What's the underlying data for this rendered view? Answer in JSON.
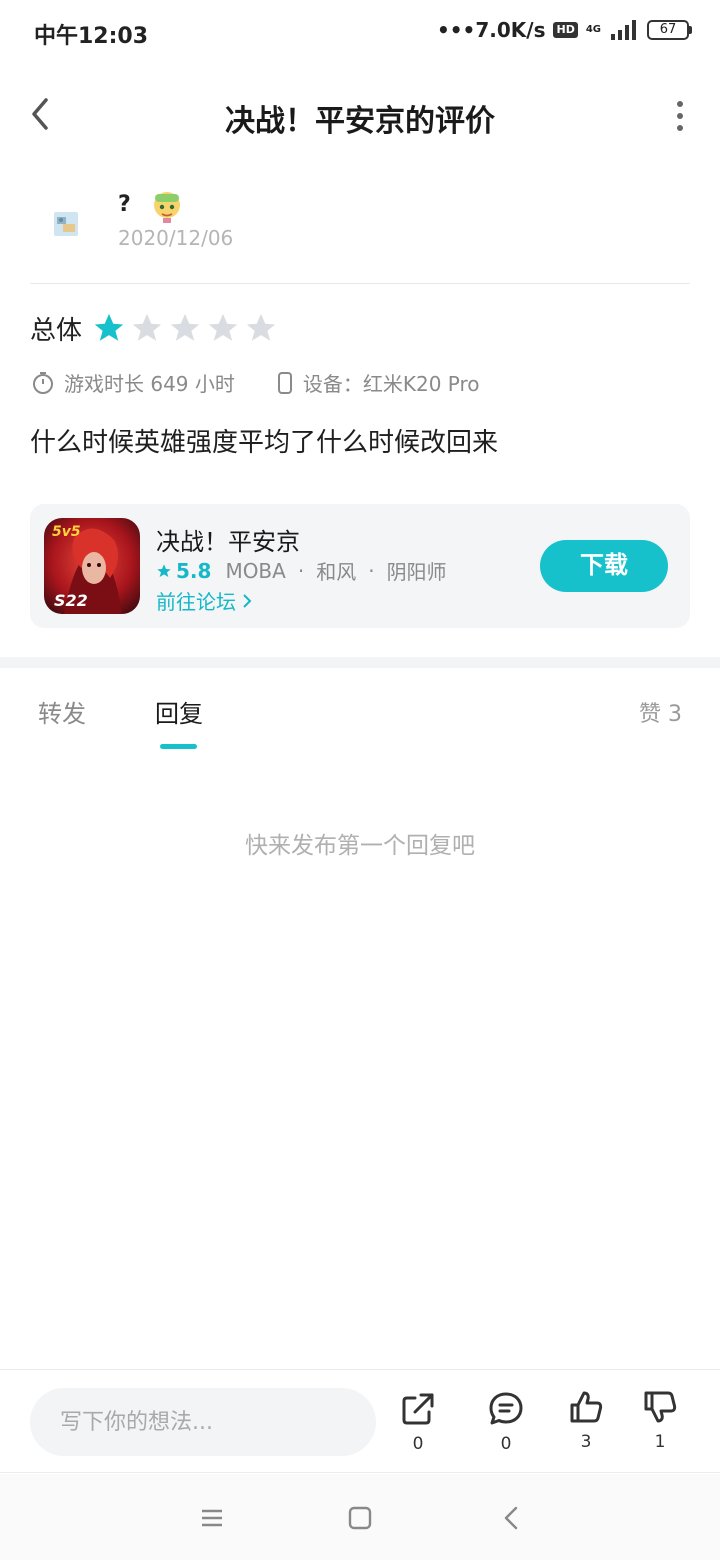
{
  "status_bar": {
    "time": "中午12:03",
    "speed": "•••7.0K/s",
    "hd": "HD",
    "network": "4G",
    "battery": "67"
  },
  "header": {
    "title": "决战！平安京的评价"
  },
  "review": {
    "user_name": "?",
    "date": "2020/12/06",
    "rating_label": "总体",
    "rating": 1,
    "rating_max": 5,
    "play_time": "游戏时长 649 小时",
    "device": "设备：红米K20 Pro",
    "content": "什么时候英雄强度平均了什么时候改回来"
  },
  "game_card": {
    "name": "决战！平安京",
    "score": "5.8",
    "tags": [
      "MOBA",
      "和风",
      "阴阳师"
    ],
    "forum_link": "前往论坛",
    "download_label": "下载",
    "icon_text_top": "5v5",
    "icon_text_bottom": "S22"
  },
  "tabs": {
    "forward": "转发",
    "reply": "回复",
    "likes": "赞 3"
  },
  "empty_hint": "快来发布第一个回复吧",
  "action_bar": {
    "input_placeholder": "写下你的想法...",
    "share_count": "0",
    "comment_count": "0",
    "like_count": "3",
    "dislike_count": "1"
  },
  "colors": {
    "accent": "#16c1cb",
    "star_inactive": "#d9dde1"
  }
}
